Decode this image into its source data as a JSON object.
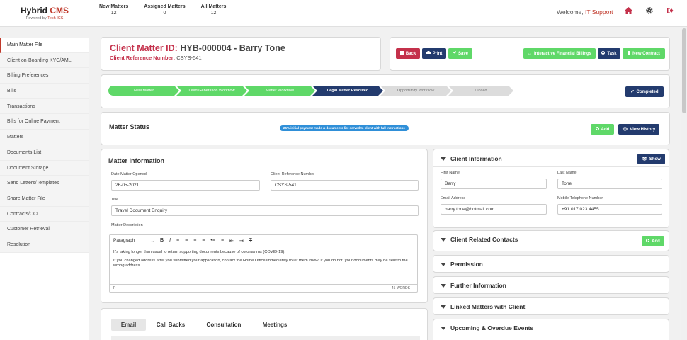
{
  "logo": {
    "name_main": "Hybrid",
    "name_accent": "CMS",
    "powered_prefix": "Powered by",
    "powered_brand": "Tech ICS"
  },
  "stats": [
    {
      "label": "New Matters",
      "count": "12"
    },
    {
      "label": "Assigned Matters",
      "count": "0"
    },
    {
      "label": "All Matters",
      "count": "12"
    }
  ],
  "header": {
    "welcome_prefix": "Welcome,",
    "user": "IT Support",
    "home_icon": "home-icon",
    "settings_icon": "gear-icon",
    "logout_icon": "logout-icon"
  },
  "sidebar": {
    "items": [
      {
        "label": "Main Matter File",
        "active": true
      },
      {
        "label": "Client on-Boarding KYC/AML"
      },
      {
        "label": "Billing Preferences"
      },
      {
        "label": "Bills"
      },
      {
        "label": "Transactions"
      },
      {
        "label": "Bills for Online Payment"
      },
      {
        "label": "Matters"
      },
      {
        "label": "Documents List"
      },
      {
        "label": "Document Storage"
      },
      {
        "label": "Send Letters/Templates"
      },
      {
        "label": "Share Matter File"
      },
      {
        "label": "Contracts/CCL"
      },
      {
        "label": "Customer Retrieval"
      },
      {
        "label": "Resolution"
      }
    ]
  },
  "matter": {
    "id_label": "Client Matter ID:",
    "id_value": "HYB-000004 - Barry Tone",
    "ref_label": "Client Reference Number:",
    "ref_value": "CSYS-541"
  },
  "actions": {
    "back": "Back",
    "print": "Print",
    "save": "Save",
    "financial": "Interactive Financial Billings",
    "task": "Task",
    "new_contract": "New Contract"
  },
  "workflow": {
    "steps": [
      {
        "label": "New Matter",
        "state": "done"
      },
      {
        "label": "Lead Generation Workflow",
        "state": "done"
      },
      {
        "label": "Matter Workflow",
        "state": "done"
      },
      {
        "label": "Legal Matter Resolved",
        "state": "current"
      },
      {
        "label": "Opportunity Workflow",
        "state": "todo"
      },
      {
        "label": "Closed",
        "state": "todo"
      }
    ],
    "completed_label": "Completed"
  },
  "matter_status": {
    "title": "Matter Status",
    "badge": "25% initial payment made & documents list served to client with full instructions",
    "add_label": "Add",
    "history_label": "View History"
  },
  "matter_info": {
    "title": "Matter Information",
    "date_opened_label": "Date Matter Opened",
    "date_opened": "26-05-2021",
    "client_ref_label": "Client Reference Number",
    "client_ref": "CSYS-541",
    "title_label": "Title",
    "title_value": "Travel Document Enquiry",
    "desc_label": "Matter Description",
    "toolbar_paragraph": "Paragraph",
    "desc_p1": "It's taking longer than usual to return supporting documents because of coronavirus (COVID-19).",
    "desc_p2": "If you changed address after you submitted your application, contact the Home Office immediately to let them know. If you do not, your documents may be sent to the wrong address.",
    "path": "P",
    "word_count": "45 WORDS"
  },
  "tabs": [
    {
      "label": "Email",
      "active": true
    },
    {
      "label": "Call Backs"
    },
    {
      "label": "Consultation"
    },
    {
      "label": "Meetings"
    }
  ],
  "client_info": {
    "title": "Client Information",
    "show_label": "Show",
    "first_name_label": "First Name",
    "first_name": "Barry",
    "last_name_label": "Last Name",
    "last_name": "Tone",
    "email_label": "Email Address",
    "email": "barry.tone@hotmail.com",
    "mobile_label": "Mobile Telephone Number",
    "mobile": "+91 017 023 4455"
  },
  "accordions": {
    "related_contacts": "Client Related Contacts",
    "related_add": "Add",
    "permission": "Permission",
    "further_info": "Further Information",
    "linked_matters": "Linked Matters with Client",
    "upcoming": "Upcoming & Overdue Events"
  },
  "colors": {
    "accent_red": "#c4314b",
    "navy": "#233b6e",
    "green": "#5fd868",
    "badge_blue": "#2f8fd8"
  }
}
